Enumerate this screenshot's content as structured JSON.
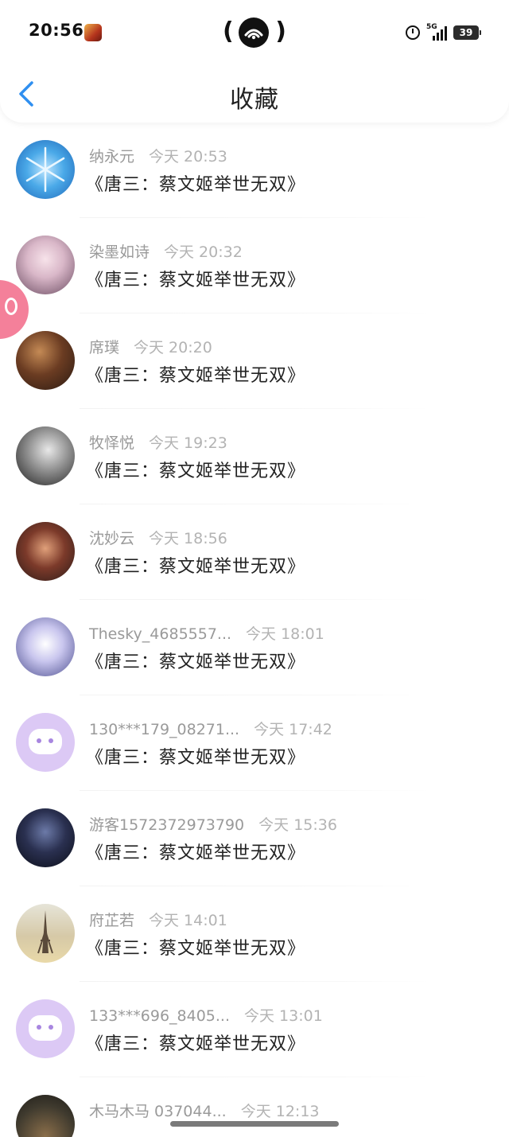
{
  "status_bar": {
    "time": "20:56",
    "network": "5G",
    "battery": "39"
  },
  "header": {
    "title": "收藏",
    "back_icon": "chevron-left-icon"
  },
  "colors": {
    "accent": "#2f8ff0",
    "float_bubble": "#f4809a",
    "default_avatar": "#dcc9f5"
  },
  "items": [
    {
      "user": "纳永元",
      "time": "今天 20:53",
      "title": "《唐三：蔡文姬举世无双》",
      "avatar": "snow"
    },
    {
      "user": "染墨如诗",
      "time": "今天 20:32",
      "title": "《唐三：蔡文姬举世无双》",
      "avatar": "anime-girl"
    },
    {
      "user": "席璞",
      "time": "今天 20:20",
      "title": "《唐三：蔡文姬举世无双》",
      "avatar": "dark-portrait"
    },
    {
      "user": "牧怿悦",
      "time": "今天 19:23",
      "title": "《唐三：蔡文姬举世无双》",
      "avatar": "bw-portrait"
    },
    {
      "user": "沈妙云",
      "time": "今天 18:56",
      "title": "《唐三：蔡文姬举世无双》",
      "avatar": "anime-warrior"
    },
    {
      "user": "Thesky_4685557...",
      "time": "今天 18:01",
      "title": "《唐三：蔡文姬举世无双》",
      "avatar": "anime-silver"
    },
    {
      "user": "130***179_08271...",
      "time": "今天 17:42",
      "title": "《唐三：蔡文姬举世无双》",
      "avatar": "default"
    },
    {
      "user": "游客1572372973790",
      "time": "今天 15:36",
      "title": "《唐三：蔡文姬举世无双》",
      "avatar": "dark-male"
    },
    {
      "user": "府芷若",
      "time": "今天 14:01",
      "title": "《唐三：蔡文姬举世无双》",
      "avatar": "eiffel"
    },
    {
      "user": "133***696_8405...",
      "time": "今天 13:01",
      "title": "《唐三：蔡文姬举世无双》",
      "avatar": "default"
    },
    {
      "user": "木马木马  037044...",
      "time": "今天 12:13",
      "title": "",
      "avatar": "tree"
    }
  ]
}
